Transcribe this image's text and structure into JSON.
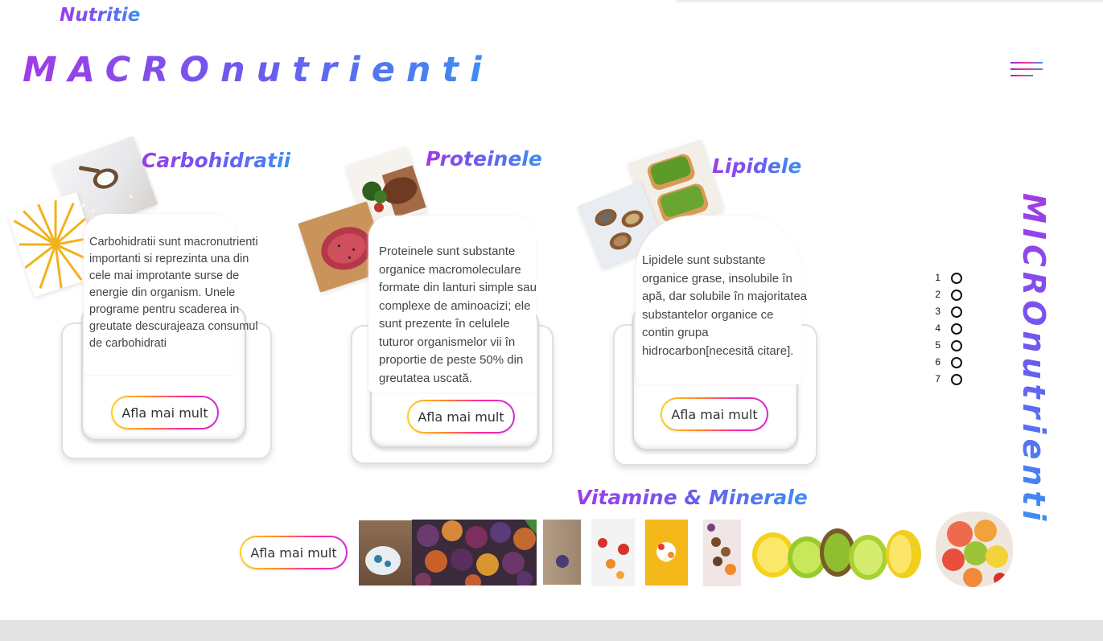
{
  "brand": "Nutritie",
  "hero_title": "MACROnutrienti",
  "vertical_title": "MICROnutrienti",
  "cards": [
    {
      "title": "Carbohidratii",
      "text": "Carbohidratii sunt macronutrienti importanti si reprezinta una din cele mai improtante surse de energie din organism. Unele programe pentru scaderea in greutate descurajeaza consumul de carbohidrati",
      "button": "Afla mai mult"
    },
    {
      "title": "Proteinele",
      "text": "Proteinele sunt substante organice macromoleculare formate din lanturi simple sau complexe de aminoacizi; ele sunt prezente în celulele tuturor organismelor vii în proportie de peste 50% din greutatea uscată.",
      "button": "Afla mai mult"
    },
    {
      "title": "Lipidele",
      "text": "Lipidele sunt substante organice grase, insolubile în apă, dar solubile în majoritatea substantelor organice ce contin grupa hidrocarbon[necesită citare].",
      "button": "Afla mai mult"
    }
  ],
  "pager": [
    "1",
    "2",
    "3",
    "4",
    "5",
    "6",
    "7"
  ],
  "vitamins": {
    "title": "Vitamine & Minerale",
    "button": "Afla mai mult"
  },
  "colors": {
    "gradient_start": "#a03ce6",
    "gradient_end": "#3d8ff0",
    "button_border_start": "#ffd21f",
    "button_border_end": "#d02bd8"
  }
}
